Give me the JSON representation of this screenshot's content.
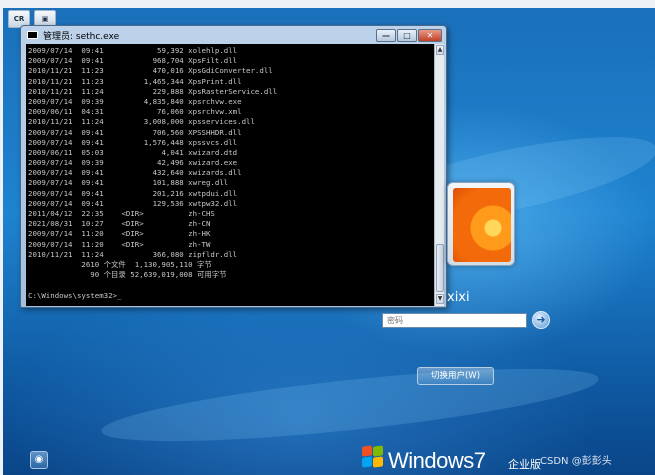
{
  "taskbar": {
    "buttons": [
      "CR",
      ""
    ]
  },
  "console_window": {
    "title": "管理员: sethc.exe",
    "lines": [
      "2009/07/14  09:41            59,392 xolehlp.dll",
      "2009/07/14  09:41           968,704 XpsFilt.dll",
      "2010/11/21  11:23           470,016 XpsGdiConverter.dll",
      "2010/11/21  11:23         1,465,344 XpsPrint.dll",
      "2010/11/21  11:24           229,888 XpsRasterService.dll",
      "2009/07/14  09:39         4,835,840 xpsrchvw.exe",
      "2009/06/11  04:31            76,060 xpsrchvw.xml",
      "2010/11/21  11:24         3,008,000 xpsservices.dll",
      "2009/07/14  09:41           706,560 XPSSHHDR.dll",
      "2009/07/14  09:41         1,576,448 xpssvcs.dll",
      "2009/06/11  05:03             4,041 xwizard.dtd",
      "2009/07/14  09:39            42,496 xwizard.exe",
      "2009/07/14  09:41           432,640 xwizards.dll",
      "2009/07/14  09:41           101,888 xwreg.dll",
      "2009/07/14  09:41           201,216 xwtpdui.dll",
      "2009/07/14  09:41           129,536 xwtpw32.dll",
      "2011/04/12  22:35    <DIR>          zh-CHS",
      "2021/08/31  10:27    <DIR>          zh-CN",
      "2009/07/14  11:20    <DIR>          zh-HK",
      "2009/07/14  11:20    <DIR>          zh-TW",
      "2010/11/21  11:24           366,080 zipfldr.dll",
      "            2610 个文件  1,130,905,110 字节",
      "              90 个目录 52,639,019,008 可用字节",
      "",
      "C:\\Windows\\system32>_"
    ],
    "controls": {
      "minimize": "—",
      "maximize": "□",
      "close": "✕"
    },
    "scroll_up": "▲",
    "scroll_down": "▼"
  },
  "logon": {
    "username": "xixi",
    "password_placeholder": "密码",
    "go_arrow": "➜",
    "switch_user": "切换用户(W)"
  },
  "footer": {
    "accessibility_icon": "◉",
    "brand": "Windows",
    "seven": "7",
    "edition": "企业版",
    "watermark": "CSDN @彭彭头"
  },
  "colors": {
    "logo_red": "#f25022",
    "logo_green": "#7fba00",
    "logo_blue": "#00a4ef",
    "logo_yellow": "#ffb900"
  }
}
